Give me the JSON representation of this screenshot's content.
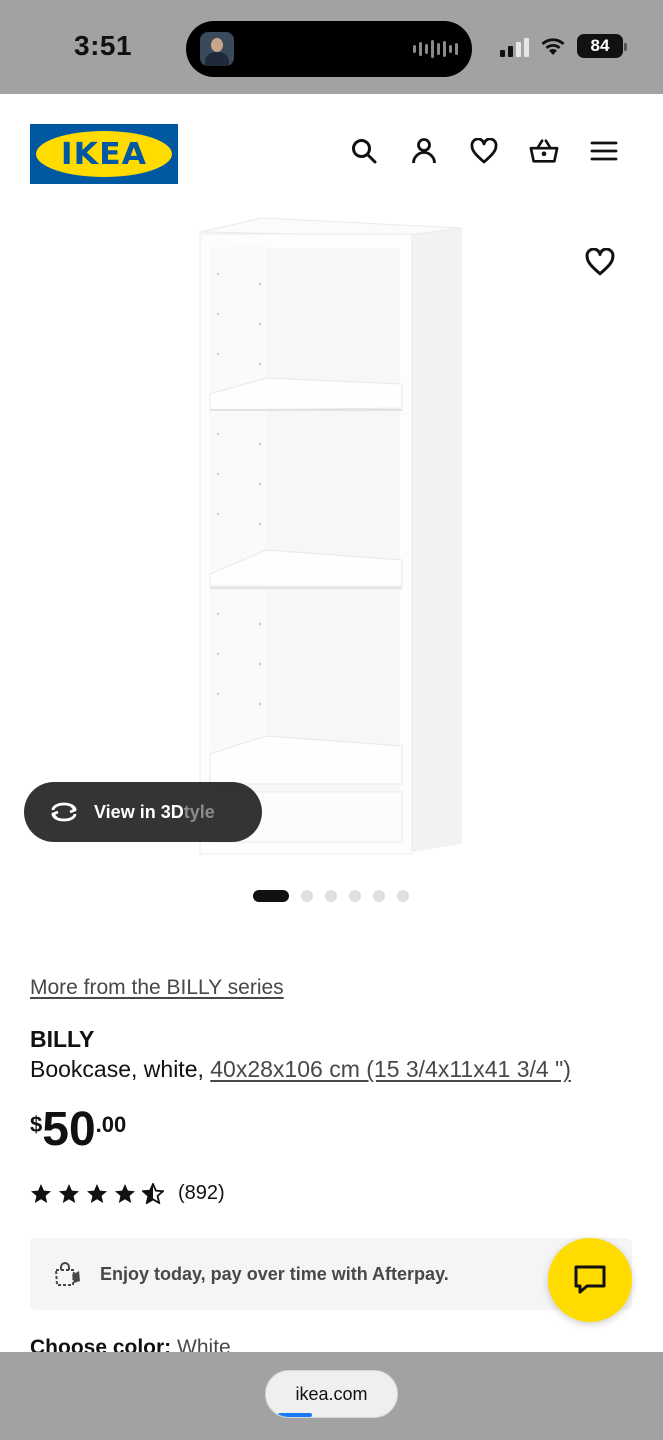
{
  "status_bar": {
    "time": "3:51",
    "battery": "84",
    "icons": [
      "cellular-signal-icon",
      "wifi-icon",
      "battery-icon"
    ]
  },
  "header": {
    "logo_text": "IKEA",
    "icons": [
      "search-icon",
      "account-icon",
      "heart-icon",
      "basket-icon",
      "menu-icon"
    ],
    "colors": {
      "brand_blue": "#0058a3",
      "brand_yellow": "#ffdb00"
    }
  },
  "gallery": {
    "view_3d_label": "View in 3D",
    "view_3d_ghost_text": "tyle",
    "dot_count": 6,
    "active_dot": 0
  },
  "product": {
    "series_link": "More from the BILLY series",
    "name": "BILLY",
    "desc_prefix": "Bookcase, white, ",
    "dimensions": "40x28x106 cm (15 3/4x11x41 3/4 \")",
    "price_currency": "$",
    "price_integer": "50",
    "price_decimal": ".00",
    "rating_stars": 4.5,
    "review_count": "(892)"
  },
  "afterpay": {
    "text": "Enjoy today, pay over time with Afterpay."
  },
  "color_choice": {
    "label": "Choose color:",
    "value": "White"
  },
  "browser": {
    "url": "ikea.com"
  }
}
